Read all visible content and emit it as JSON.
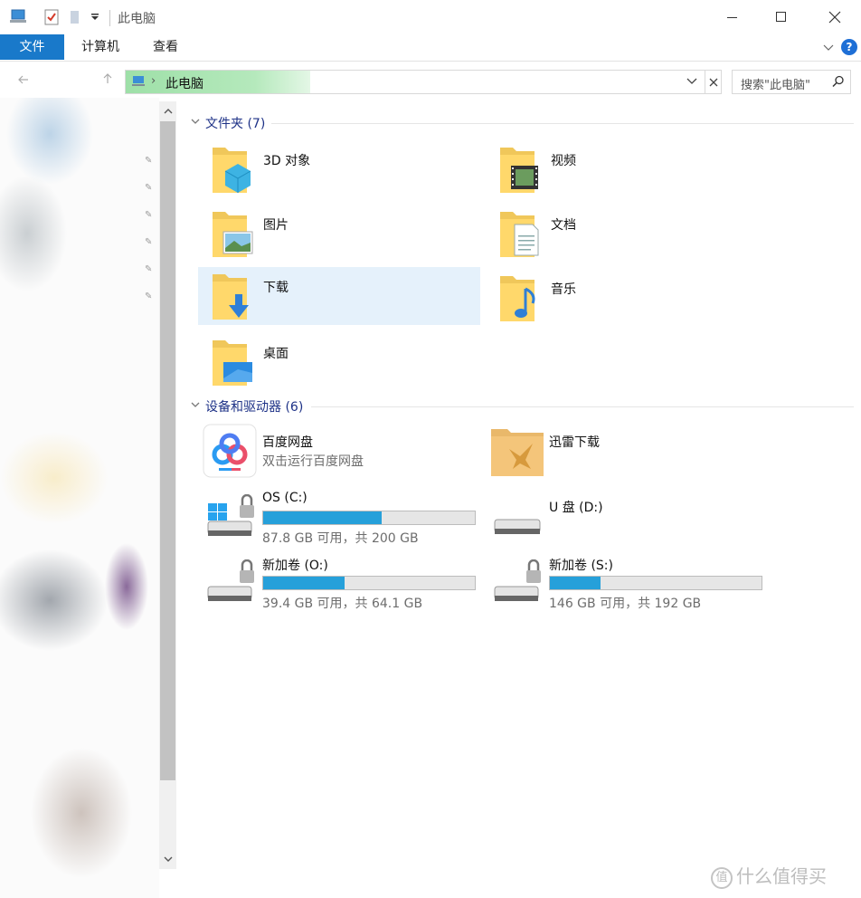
{
  "window": {
    "title": "此电脑",
    "minimize_glyph": "—",
    "maximize_glyph": "☐",
    "close_glyph": "✕"
  },
  "ribbon": {
    "tabs": [
      {
        "label": "文件",
        "active": true
      },
      {
        "label": "计算机",
        "active": false
      },
      {
        "label": "查看",
        "active": false
      }
    ],
    "help_glyph": "?"
  },
  "address": {
    "separator": "›",
    "path": "此电脑",
    "accent": "#9ee0a8"
  },
  "search": {
    "placeholder": "搜索\"此电脑\""
  },
  "groups": {
    "folders": {
      "title": "文件夹 (7)",
      "items": [
        {
          "label": "3D 对象",
          "icon": "3d-objects-folder-icon"
        },
        {
          "label": "视频",
          "icon": "videos-folder-icon"
        },
        {
          "label": "图片",
          "icon": "pictures-folder-icon"
        },
        {
          "label": "文档",
          "icon": "documents-folder-icon"
        },
        {
          "label": "下载",
          "icon": "downloads-folder-icon",
          "selected": true
        },
        {
          "label": "音乐",
          "icon": "music-folder-icon"
        },
        {
          "label": "桌面",
          "icon": "desktop-folder-icon"
        }
      ]
    },
    "devices": {
      "title": "设备和驱动器 (6)",
      "items": [
        {
          "name": "百度网盘",
          "sub": "双击运行百度网盘",
          "icon": "baidu-netdisk-icon"
        },
        {
          "name": "迅雷下载",
          "icon": "xunlei-download-icon"
        },
        {
          "name": "OS (C:)",
          "sub": "87.8 GB 可用，共 200 GB",
          "used_fraction": 0.561,
          "icon": "windows-drive-icon"
        },
        {
          "name": "U 盘 (D:)",
          "icon": "usb-drive-icon"
        },
        {
          "name": "新加卷 (O:)",
          "sub": "39.4 GB 可用，共 64.1 GB",
          "used_fraction": 0.385,
          "icon": "locked-drive-icon"
        },
        {
          "name": "新加卷 (S:)",
          "sub": "146 GB 可用，共 192 GB",
          "used_fraction": 0.24,
          "icon": "locked-drive-icon"
        }
      ]
    }
  },
  "colors": {
    "ribbon_active": "#1979ca",
    "group_title": "#1e3287",
    "selection": "#e5f1fb",
    "drive_fill": "#26a0da"
  },
  "watermark": {
    "logo": "值",
    "text": "什么值得买"
  }
}
